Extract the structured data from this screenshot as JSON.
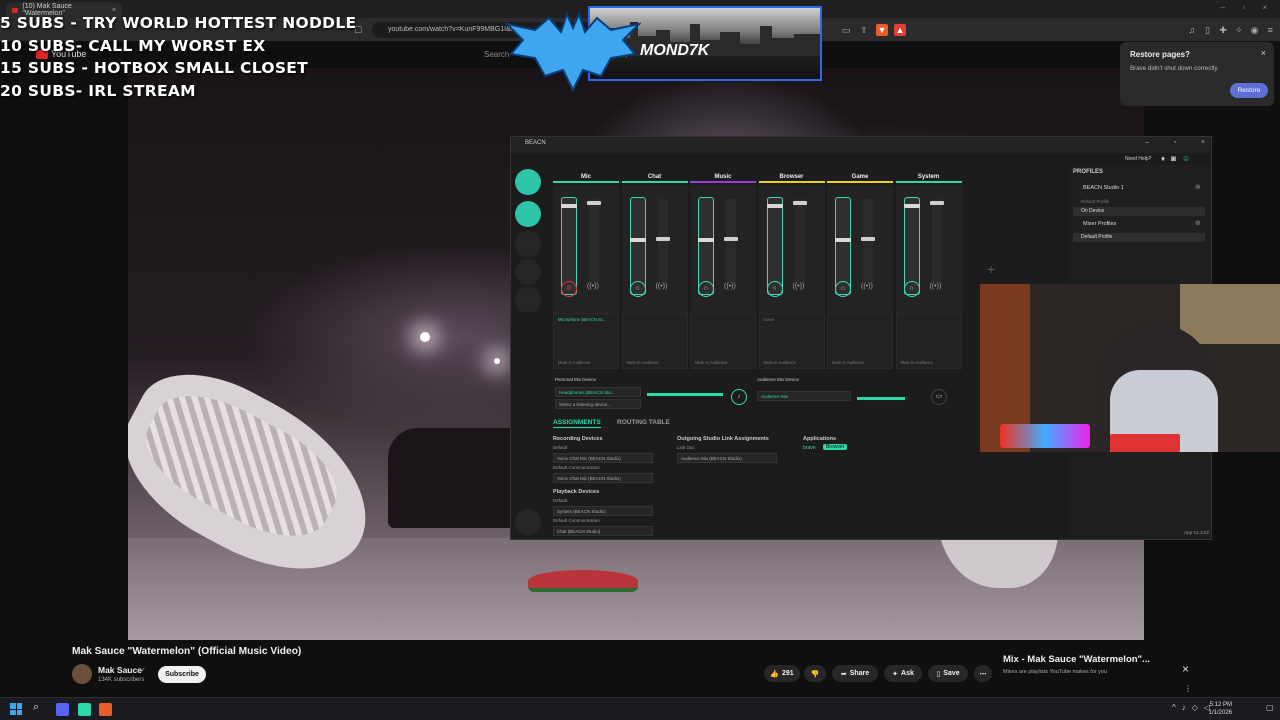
{
  "browser": {
    "tab_title": "(10) Mak Sauce \"Watermelon\"",
    "url": "youtube.com/watch?v=KunF99MBG1I&list",
    "search_placeholder": "Search",
    "logo_text": "YouTube"
  },
  "overlay": {
    "sub_goals": [
      "5 SUBS - TRY WORLD HOTTEST NODDLE",
      "10 SUBS- CALL MY WORST EX",
      "15 SUBS - HOTBOX SMALL CLOSET",
      "20 SUBS- IRL STREAM"
    ],
    "twitter_handle": "MOND7K"
  },
  "restore_popup": {
    "title": "Restore pages?",
    "message": "Brave didn't shut down correctly.",
    "button": "Restore"
  },
  "beacn": {
    "window_title": "BEACN",
    "need_help": "Need Help?",
    "channels": [
      {
        "name": "Mic",
        "color": "#2ed9a8",
        "routing": "Microphone (BEACN St...",
        "mute": "Mute to Audience"
      },
      {
        "name": "Chat",
        "color": "#2ed9a8",
        "routing": "",
        "mute": "Mute to Audience"
      },
      {
        "name": "Music",
        "color": "#9b3dd6",
        "routing": "",
        "mute": "Mute to Audience"
      },
      {
        "name": "Browser",
        "color": "#e8d020",
        "routing": "brave",
        "mute": "Mute to Audience"
      },
      {
        "name": "Game",
        "color": "#e8d020",
        "routing": "",
        "mute": "Mute to Audience"
      },
      {
        "name": "System",
        "color": "#2ed9a8",
        "routing": "",
        "mute": "Mute to Audience"
      }
    ],
    "personal_mix_label": "Personal Mix Device",
    "personal_mix_device": "Headphones (BEACN Stu...",
    "listening_device_placeholder": "Select a listening device...",
    "audience_mix_label": "Audience Mix Device",
    "audience_mix_device": "Audience Mix",
    "tabs": [
      "ASSIGNMENTS",
      "ROUTING TABLE"
    ],
    "recording_devices": "Recording Devices",
    "default_label": "Default",
    "default_comm_label": "Default Communication",
    "rec_default_value": "Voice Chat Mic (BEACN Studio)",
    "rec_comm_value": "Voice Chat Mic (BEACN Studio)",
    "playback_devices": "Playback Devices",
    "play_default_value": "System (BEACN Studio)",
    "play_comm_value": "Chat (BEACN Studio)",
    "outgoing_label": "Outgoing Studio Link Assignments",
    "link_out": "Link Out",
    "link_out_value": "Audience Mix (BEACN Studio)",
    "applications_label": "Applications",
    "app_name": "brave",
    "app_tag": "Browser",
    "profiles_title": "PROFILES",
    "device_name": "BEACN Studio 1",
    "default_profile": "Default Profile",
    "on_device": "On Device",
    "mixer_profiles": "Mixer Profiles",
    "mixer_default": "Default Profile",
    "version": "App V1.2.02"
  },
  "video": {
    "title": "Mak Sauce \"Watermelon\" (Official Music Video)",
    "channel": "Mak Sauce",
    "subscribers": "134K subscribers",
    "subscribe": "Subscribe",
    "likes": "291",
    "share": "Share",
    "ask": "Ask",
    "save": "Save"
  },
  "mix": {
    "title": "Mix - Mak Sauce \"Watermelon\"...",
    "subtitle": "Mixes are playlists YouTube makes for you"
  },
  "taskbar": {
    "time": "5:12 PM",
    "date": "1/1/2026"
  }
}
